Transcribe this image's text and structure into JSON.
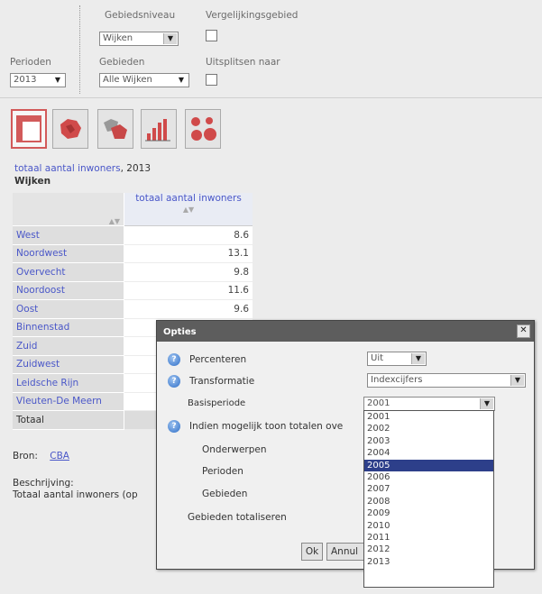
{
  "filters": {
    "gebiedsniveau_label": "Gebiedsniveau",
    "gebiedsniveau_value": "Wijken",
    "vergelijkingsgebied_label": "Vergelijkingsgebied",
    "perioden_label": "Perioden",
    "perioden_value": "2013",
    "gebieden_label": "Gebieden",
    "gebieden_value": "Alle Wijken",
    "uitsplitsen_label": "Uitsplitsen naar"
  },
  "view_icons": [
    "table-icon",
    "map-icon",
    "multi-map-icon",
    "bar-chart-icon",
    "pie-chart-icon"
  ],
  "table": {
    "title_link": "totaal aantal inwoners",
    "title_rest": ", 2013",
    "subtitle": "Wijken",
    "column_header": "totaal aantal inwoners",
    "sort_glyph": "▲▼",
    "rows": [
      {
        "name": "West",
        "value": "8.6"
      },
      {
        "name": "Noordwest",
        "value": "13.1"
      },
      {
        "name": "Overvecht",
        "value": "9.8"
      },
      {
        "name": "Noordoost",
        "value": "11.6"
      },
      {
        "name": "Oost",
        "value": "9.6"
      },
      {
        "name": "Binnenstad",
        "value": ""
      },
      {
        "name": "Zuid",
        "value": ""
      },
      {
        "name": "Zuidwest",
        "value": ""
      },
      {
        "name": "Leidsche Rijn",
        "value": ""
      },
      {
        "name": "Vleuten-De Meern",
        "value": ""
      }
    ],
    "total_label": "Totaal"
  },
  "footer": {
    "bron_label": "Bron:",
    "bron_value": "CBA",
    "beschrijving_label": "Beschrijving:",
    "beschrijving_text": "Totaal aantal inwoners (op"
  },
  "dialog": {
    "title": "Opties",
    "close_glyph": "✕",
    "info_glyph": "?",
    "percenteren_label": "Percenteren",
    "percenteren_value": "Uit",
    "transformatie_label": "Transformatie",
    "transformatie_value": "Indexcijfers",
    "basisperiode_label": "Basisperiode",
    "basisperiode_value": "2001",
    "totalen_label": "Indien mogelijk toon totalen ove",
    "onderwerpen_label": "Onderwerpen",
    "perioden_label": "Perioden",
    "gebieden_label": "Gebieden",
    "gebieden_totaliseren_label": "Gebieden totaliseren",
    "ok_label": "Ok",
    "annuleren_label": "Annul"
  },
  "year_dropdown": {
    "options": [
      "2001",
      "2002",
      "2003",
      "2004",
      "2005",
      "2006",
      "2007",
      "2008",
      "2009",
      "2010",
      "2011",
      "2012",
      "2013"
    ],
    "highlighted": "2005"
  }
}
